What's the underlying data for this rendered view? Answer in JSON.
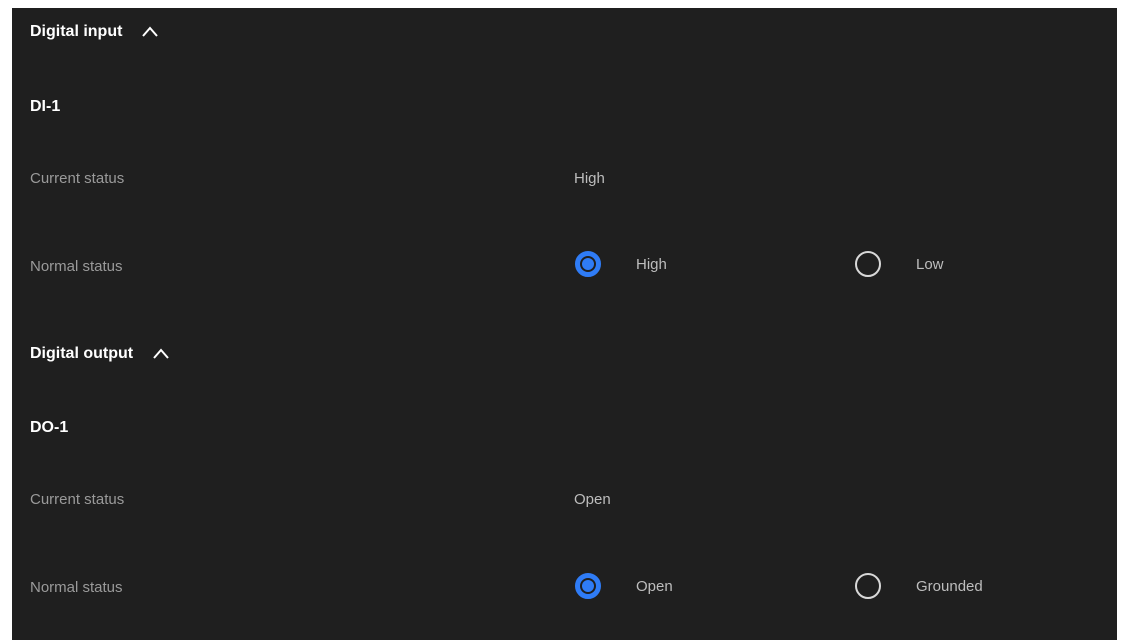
{
  "digital_input": {
    "title": "Digital input",
    "channel": "DI-1",
    "current_status_label": "Current status",
    "current_status_value": "High",
    "normal_status_label": "Normal status",
    "options": [
      {
        "label": "High",
        "selected": true
      },
      {
        "label": "Low",
        "selected": false
      }
    ]
  },
  "digital_output": {
    "title": "Digital output",
    "channel": "DO-1",
    "current_status_label": "Current status",
    "current_status_value": "Open",
    "normal_status_label": "Normal status",
    "options": [
      {
        "label": "Open",
        "selected": true
      },
      {
        "label": "Grounded",
        "selected": false
      }
    ]
  },
  "colors": {
    "background": "#1f1f1f",
    "accent": "#2f7cf6",
    "muted_text": "#9a9a9a",
    "value_text": "#bdbdbd"
  },
  "icons": {
    "collapse": "chevron-up-icon",
    "radio_checked": "radio-checked-icon",
    "radio_unchecked": "radio-unchecked-icon"
  }
}
